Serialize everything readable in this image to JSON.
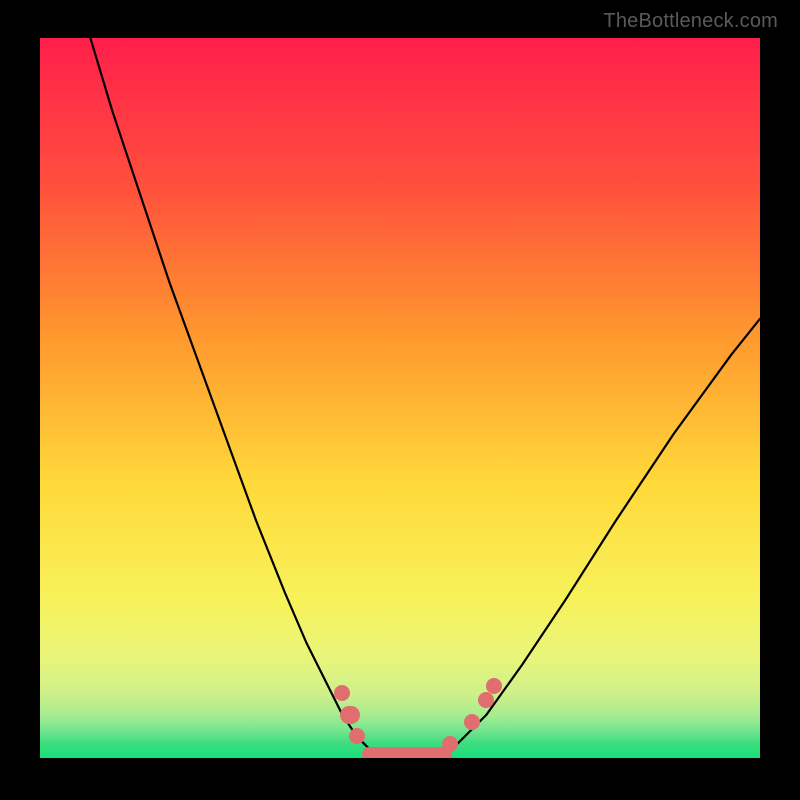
{
  "watermark": "TheBottleneck.com",
  "colors": {
    "gradient_stops": [
      {
        "pct": 0,
        "color": "#FF1F4B"
      },
      {
        "pct": 20,
        "color": "#FF4E3D"
      },
      {
        "pct": 42,
        "color": "#FF9A2E"
      },
      {
        "pct": 62,
        "color": "#FFD93A"
      },
      {
        "pct": 78,
        "color": "#F7F25A"
      },
      {
        "pct": 86,
        "color": "#E8F57A"
      },
      {
        "pct": 91,
        "color": "#CFF08A"
      },
      {
        "pct": 94,
        "color": "#A8EC8F"
      },
      {
        "pct": 96,
        "color": "#78E690"
      },
      {
        "pct": 98,
        "color": "#3EDC80"
      },
      {
        "pct": 100,
        "color": "#13E07A"
      }
    ],
    "marker": "#E06E6E",
    "curve": "#000000",
    "background": "#000000"
  },
  "chart_data": {
    "type": "line",
    "title": "",
    "xlabel": "",
    "ylabel": "",
    "xlim": [
      0,
      100
    ],
    "ylim": [
      0,
      100
    ],
    "annotations": [
      "TheBottleneck.com"
    ],
    "series": [
      {
        "name": "left-curve",
        "x": [
          7,
          10,
          14,
          18,
          22,
          26,
          30,
          34,
          37,
          40,
          42,
          44,
          46
        ],
        "y": [
          100,
          90,
          78,
          66,
          55,
          44,
          33,
          23,
          16,
          10,
          6,
          3,
          1
        ]
      },
      {
        "name": "flat-bottom",
        "x": [
          46,
          48,
          50,
          52,
          54,
          56,
          58
        ],
        "y": [
          1,
          0.5,
          0.3,
          0.3,
          0.5,
          1,
          2
        ]
      },
      {
        "name": "right-curve",
        "x": [
          58,
          62,
          67,
          73,
          80,
          88,
          96,
          100
        ],
        "y": [
          2,
          6,
          13,
          22,
          33,
          45,
          56,
          61
        ]
      }
    ],
    "markers": [
      {
        "x": 42,
        "y": 9,
        "kind": "dot"
      },
      {
        "x": 43,
        "y": 6,
        "kind": "pill-small"
      },
      {
        "x": 44,
        "y": 3,
        "kind": "dot"
      },
      {
        "x": 51,
        "y": 0.5,
        "kind": "pill-long"
      },
      {
        "x": 57,
        "y": 2,
        "kind": "dot"
      },
      {
        "x": 60,
        "y": 5,
        "kind": "dot"
      },
      {
        "x": 62,
        "y": 8,
        "kind": "dot"
      },
      {
        "x": 63,
        "y": 10,
        "kind": "dot"
      }
    ]
  }
}
